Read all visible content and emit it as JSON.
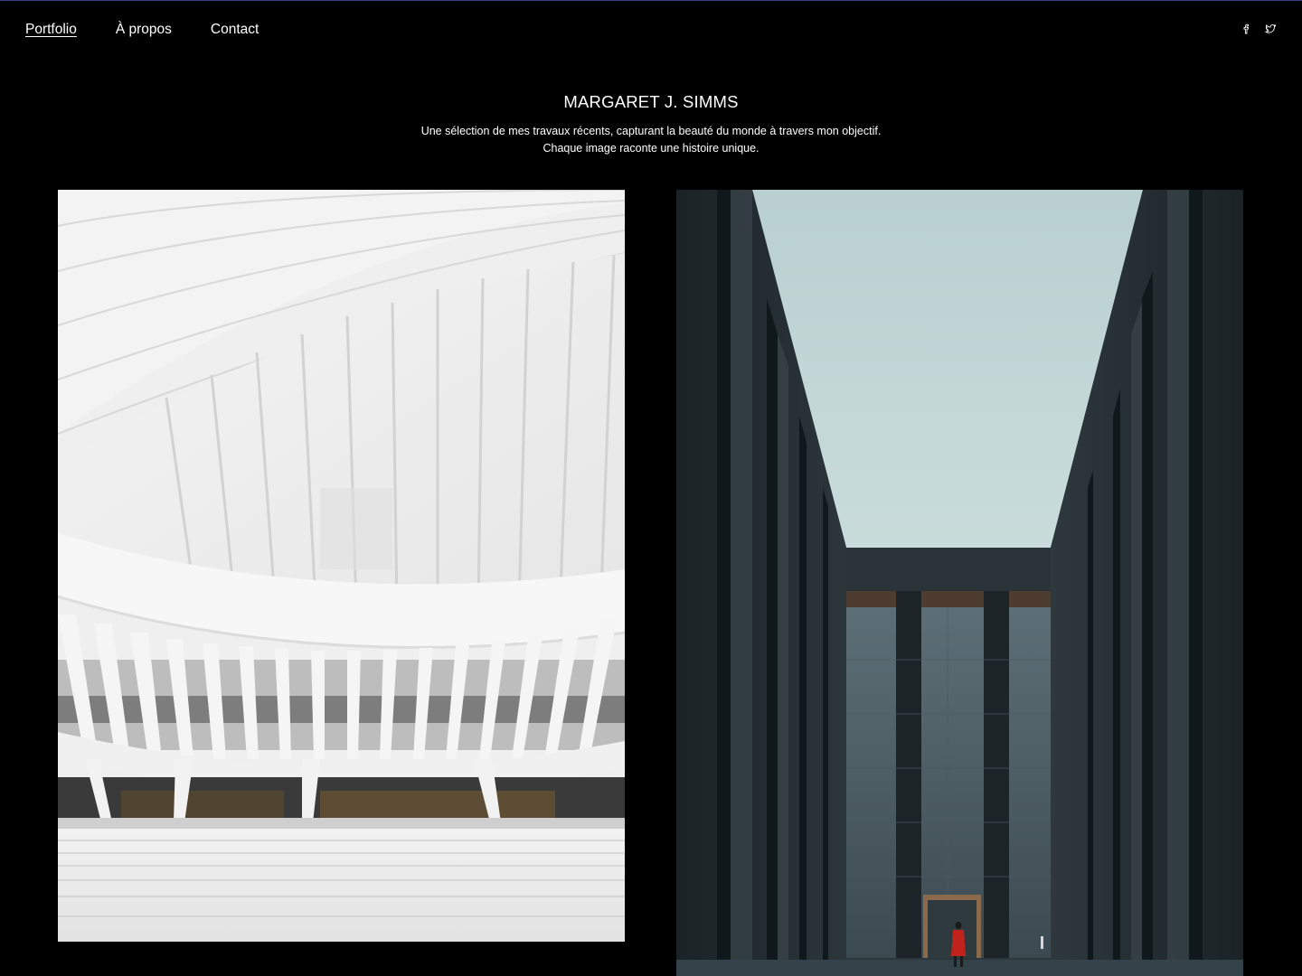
{
  "nav": {
    "items": [
      {
        "label": "Portfolio",
        "active": true
      },
      {
        "label": "À propos",
        "active": false
      },
      {
        "label": "Contact",
        "active": false
      }
    ]
  },
  "social": {
    "icons": [
      "facebook-icon",
      "twitter-icon"
    ]
  },
  "hero": {
    "name": "MARGARET J. SIMMS",
    "intro_line1": "Une sélection de mes travaux récents, capturant la beauté du monde à travers mon objectif.",
    "intro_line2": "Chaque image raconte une histoire unique."
  },
  "gallery": {
    "photos": [
      {
        "subject": "white ribbed architecture interior"
      },
      {
        "subject": "dark monolithic columns under pale sky with figure in red coat"
      }
    ]
  },
  "colors": {
    "background": "#000000",
    "text": "#ffffff",
    "accent_line": "#3b3f8a",
    "figure_coat": "#c0221c"
  }
}
